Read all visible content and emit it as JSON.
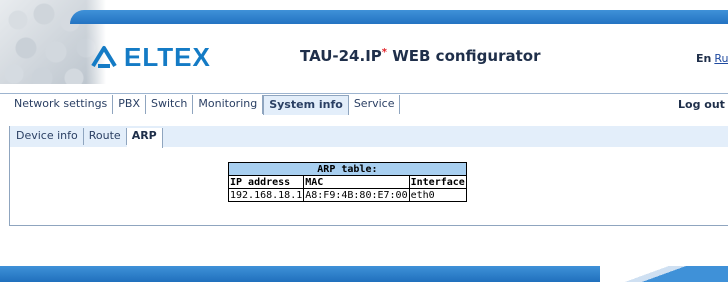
{
  "header": {
    "logo_text": "ELTEX",
    "product_name": "TAU-24.IP",
    "product_mark": "*",
    "product_suffix": " WEB configurator",
    "lang_en": "En",
    "lang_ru": "Ru",
    "logout_label": "Log out",
    "accent_color": "#147bc5"
  },
  "main_menu": {
    "items": [
      {
        "label": "Network settings",
        "active": false
      },
      {
        "label": "PBX",
        "active": false
      },
      {
        "label": "Switch",
        "active": false
      },
      {
        "label": "Monitoring",
        "active": false
      },
      {
        "label": "System info",
        "active": true
      },
      {
        "label": "Service",
        "active": false
      }
    ]
  },
  "sub_menu": {
    "items": [
      {
        "label": "Device info",
        "active": false
      },
      {
        "label": "Route",
        "active": false
      },
      {
        "label": "ARP",
        "active": true
      }
    ]
  },
  "arp_table": {
    "caption": "ARP table:",
    "columns": [
      "IP address",
      "MAC",
      "Interface"
    ],
    "rows": [
      [
        "192.168.18.1",
        "A8:F9:4B:80:E7:00",
        "eth0"
      ]
    ]
  }
}
